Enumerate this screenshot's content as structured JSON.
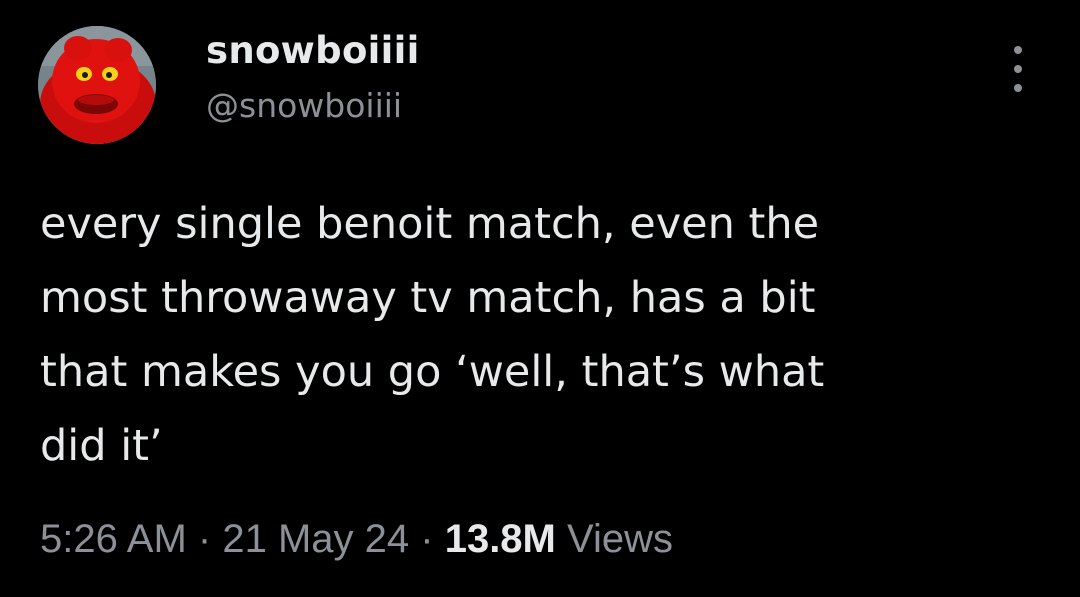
{
  "author": {
    "display_name": "snowboiiii",
    "handle": "@snowboiiii",
    "avatar_icon": "red-muppet-avatar"
  },
  "tweet": {
    "text": "every single benoit match, even the\nmost throwaway tv match, has a bit\nthat makes you go ‘well, that’s what\ndid it’"
  },
  "meta": {
    "time": "5:26 AM",
    "separator": "·",
    "date": "21 May 24",
    "views_count": "13.8M",
    "views_label": "Views"
  },
  "menu": {
    "icon": "more-options-icon"
  },
  "colors": {
    "background": "#000000",
    "primary_text": "#e7e9ea",
    "secondary_text": "#8b9196",
    "avatar_red": "#d5100f"
  }
}
